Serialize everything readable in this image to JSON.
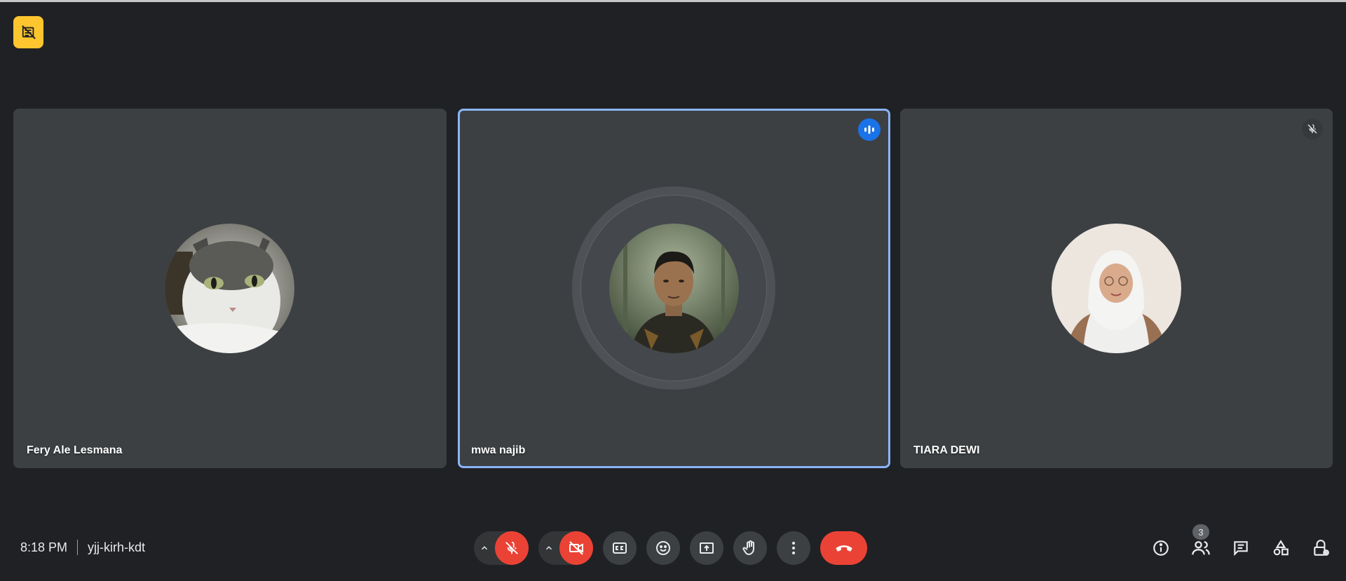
{
  "meeting": {
    "time": "8:18 PM",
    "code": "yjj-kirh-kdt"
  },
  "participants": [
    {
      "name": "Fery Ale Lesmana",
      "avatar": "cat-photo",
      "state": "idle"
    },
    {
      "name": "mwa najib",
      "avatar": "man-portrait-photo",
      "state": "speaking"
    },
    {
      "name": "TIARA DEWI",
      "avatar": "woman-hijab-photo",
      "state": "muted"
    }
  ],
  "people_count": "3",
  "colors": {
    "background": "#202124",
    "tile": "#3c4043",
    "active_border": "#8ab4f8",
    "danger": "#ea4335",
    "speaking_blue": "#1a73e8",
    "recording_badge": "#fdc62f"
  },
  "icons": {
    "top_left": "no-recording-icon",
    "controls": [
      "chevron-up-icon",
      "mic-off-icon",
      "chevron-up-icon",
      "camera-off-icon",
      "captions-icon",
      "emoji-icon",
      "present-icon",
      "raise-hand-icon",
      "more-vert-icon",
      "hangup-icon"
    ],
    "right": [
      "info-icon",
      "people-icon",
      "chat-icon",
      "activities-icon",
      "host-controls-icon"
    ]
  }
}
